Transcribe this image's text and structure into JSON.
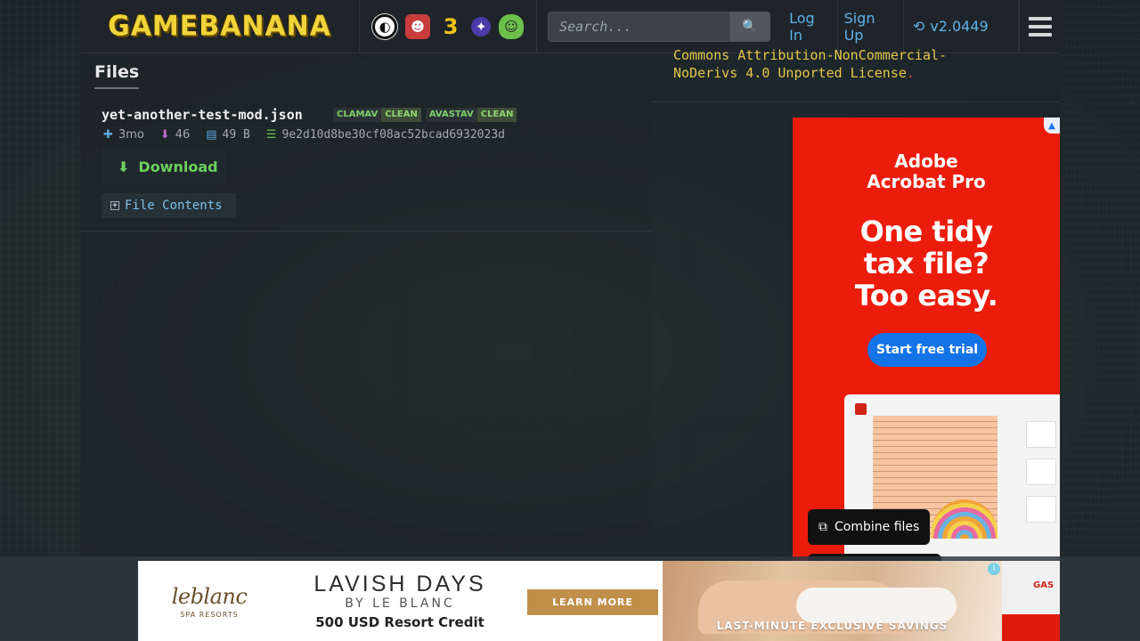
{
  "header": {
    "logo_text": "GAMEBANANA",
    "games": [
      {
        "name": "smash-bros-icon",
        "glyph": "◐"
      },
      {
        "name": "fnf-icon",
        "glyph": "☻"
      },
      {
        "name": "sonic3-air-icon",
        "glyph": "3"
      },
      {
        "name": "game4-icon",
        "glyph": "✦"
      },
      {
        "name": "baldi-icon",
        "glyph": "☺"
      }
    ],
    "search_placeholder": "Search...",
    "search_icon": "🔍",
    "login_label": "Log In",
    "signup_label": "Sign Up",
    "version_icon": "⟲",
    "version_label": "v2.0449",
    "menu_icon": "hamburger-icon"
  },
  "files": {
    "title": "Files",
    "file_name": "yet-another-test-mod.json",
    "scanners": [
      {
        "engine": "CLAMAV",
        "result": "CLEAN"
      },
      {
        "engine": "AVASTAV",
        "result": "CLEAN"
      }
    ],
    "added": "3mo",
    "downloads": "46",
    "size": "49 B",
    "md5": "9e2d10d8be30cf08ac52bcad6932023d",
    "download_label": "Download",
    "file_contents_label": "File Contents"
  },
  "license": {
    "line1": "Commons Attribution-NonCommercial-",
    "line2": "NoDerivs 4.0 Unported License",
    "period": "."
  },
  "ad_right": {
    "brand_line1": "Adobe",
    "brand_line2": "Acrobat Pro",
    "headline_line1": "One tidy",
    "headline_line2": "tax file?",
    "headline_line3": "Too easy.",
    "cta": "Start free trial",
    "combine_label": "Combine files",
    "colors": {
      "bg": "#ec1c0c",
      "cta": "#1473e6"
    }
  },
  "ad_bottom": {
    "logo": "leblanc",
    "logo_sub": "SPA RESORTS",
    "title": "LAVISH DAYS",
    "subtitle": "BY LE BLANC",
    "offer": "500 USD Resort Credit",
    "cta": "LEARN MORE",
    "tagline": "LAST-MINUTE EXCLUSIVE SAVINGS",
    "side_text": "GAS"
  }
}
